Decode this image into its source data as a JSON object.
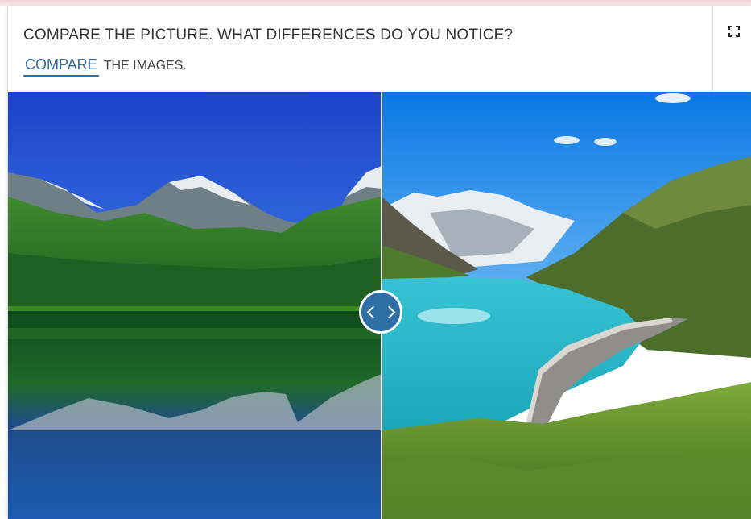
{
  "header": {
    "title": "COMPARE THE PICTURE. WHAT DIFFERENCES DO YOU NOTICE?",
    "compare_link": "COMPARE",
    "subtitle_rest": "THE IMAGES."
  },
  "slider": {
    "position_fraction": 0.5
  },
  "icons": {
    "expand": "expand-icon",
    "handle_left": "chevron-left-icon",
    "handle_right": "chevron-right-icon"
  },
  "colors": {
    "accent": "#2f6fa5",
    "text": "#333333"
  }
}
